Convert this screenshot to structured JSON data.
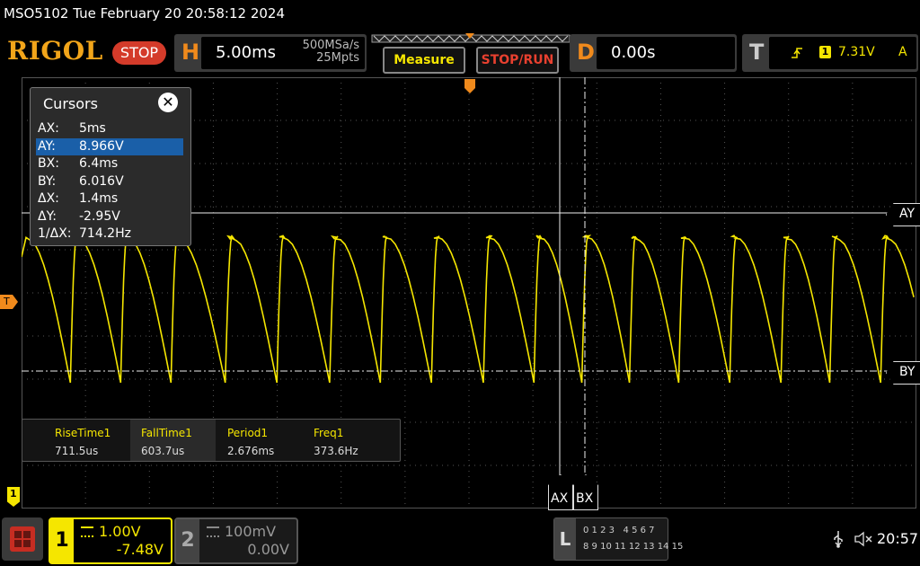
{
  "header": {
    "title": "MSO5102  Tue February 20 20:58:12 2024"
  },
  "toolbar": {
    "logo": "RIGOL",
    "run_state": "STOP",
    "horizontal": {
      "letter": "H",
      "timebase": "5.00ms",
      "sample_rate": "500MSa/s",
      "memory_depth": "25Mpts"
    },
    "measure_label": "Measure",
    "stop_run_label": "STOP/RUN",
    "delay": {
      "letter": "D",
      "value": "0.00s"
    },
    "trigger": {
      "letter": "T",
      "source": "1",
      "level": "7.31V",
      "mode": "A"
    }
  },
  "cursors": {
    "title": "Cursors",
    "rows": [
      {
        "key": "AX:",
        "value": "5ms"
      },
      {
        "key": "AY:",
        "value": "8.966V"
      },
      {
        "key": "BX:",
        "value": "6.4ms"
      },
      {
        "key": "BY:",
        "value": "6.016V"
      },
      {
        "key": "ΔX:",
        "value": "1.4ms"
      },
      {
        "key": "ΔY:",
        "value": "-2.95V"
      },
      {
        "key": "1/ΔX:",
        "value": "714.2Hz"
      }
    ],
    "selected_row": 1,
    "tags": {
      "ay": "AY",
      "by": "BY",
      "ax": "AX",
      "bx": "BX"
    }
  },
  "markers": {
    "trigger_level": "T",
    "channel1": "1"
  },
  "measurements": [
    {
      "label": "RiseTime1",
      "value": "711.5us"
    },
    {
      "label": "FallTime1",
      "value": "603.7us"
    },
    {
      "label": "Period1",
      "value": "2.676ms"
    },
    {
      "label": "Freq1",
      "value": "373.6Hz"
    }
  ],
  "channels": {
    "ch1": {
      "number": "1",
      "scale": "1.00V",
      "offset": "-7.48V",
      "color": "#f5e600"
    },
    "ch2": {
      "number": "2",
      "scale": "100mV",
      "offset": "0.00V",
      "color": "#666666"
    }
  },
  "logic": {
    "letter": "L",
    "row1": "0 1 2 3   4 5 6 7",
    "row2": "8 9 10 11 12 13 14 15"
  },
  "status": {
    "time": "20:57"
  },
  "colors": {
    "trace": "#f5e600",
    "accent": "#f08a1c",
    "stop": "#d43b2a",
    "selection": "#1a5fa8"
  }
}
